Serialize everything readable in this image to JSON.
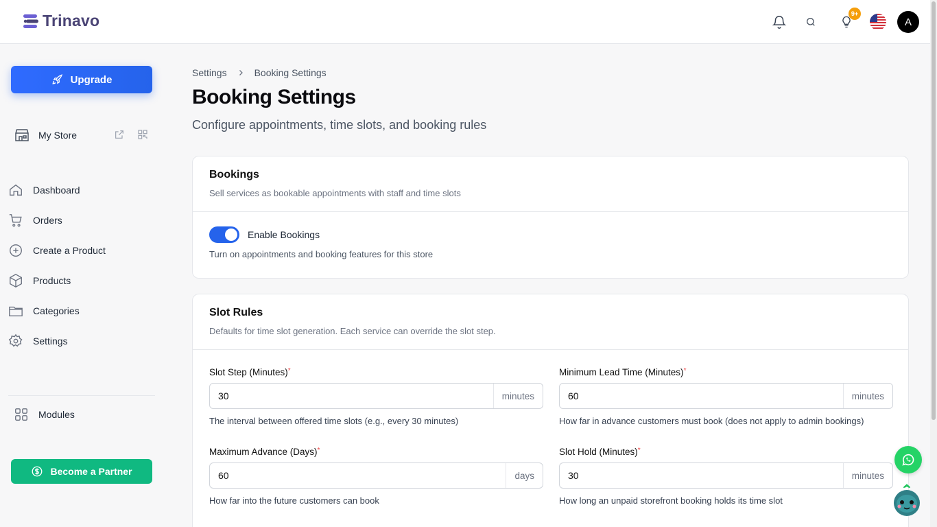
{
  "brand": {
    "name": "Trinavo"
  },
  "header": {
    "notifications_badge": "9+",
    "avatar_initial": "A"
  },
  "sidebar": {
    "upgrade_label": "Upgrade",
    "store_label": "My Store",
    "items": [
      {
        "label": "Dashboard",
        "icon": "home-icon"
      },
      {
        "label": "Orders",
        "icon": "cart-icon"
      },
      {
        "label": "Create a Product",
        "icon": "plus-circle-icon"
      },
      {
        "label": "Products",
        "icon": "box-icon"
      },
      {
        "label": "Categories",
        "icon": "folder-icon"
      },
      {
        "label": "Settings",
        "icon": "gear-icon"
      }
    ],
    "modules_label": "Modules",
    "partner_label": "Become a Partner"
  },
  "breadcrumb": {
    "root": "Settings",
    "current": "Booking Settings"
  },
  "page": {
    "title": "Booking Settings",
    "subtitle": "Configure appointments, time slots, and booking rules"
  },
  "bookings_card": {
    "title": "Bookings",
    "description": "Sell services as bookable appointments with staff and time slots",
    "toggle_label": "Enable Bookings",
    "toggle_help": "Turn on appointments and booking features for this store",
    "enabled": true
  },
  "slot_card": {
    "title": "Slot Rules",
    "description": "Defaults for time slot generation. Each service can override the slot step.",
    "fields": [
      {
        "label": "Slot Step (Minutes)",
        "value": "30",
        "unit": "minutes",
        "help": "The interval between offered time slots (e.g., every 30 minutes)"
      },
      {
        "label": "Minimum Lead Time (Minutes)",
        "value": "60",
        "unit": "minutes",
        "help": "How far in advance customers must book (does not apply to admin bookings)"
      },
      {
        "label": "Maximum Advance (Days)",
        "value": "60",
        "unit": "days",
        "help": "How far into the future customers can book"
      },
      {
        "label": "Slot Hold (Minutes)",
        "value": "30",
        "unit": "minutes",
        "help": "How long an unpaid storefront booking holds its time slot"
      }
    ]
  },
  "colors": {
    "primary": "#2563eb",
    "partner": "#10b981",
    "badge": "#f59e0b",
    "brand": "#4a4475"
  }
}
